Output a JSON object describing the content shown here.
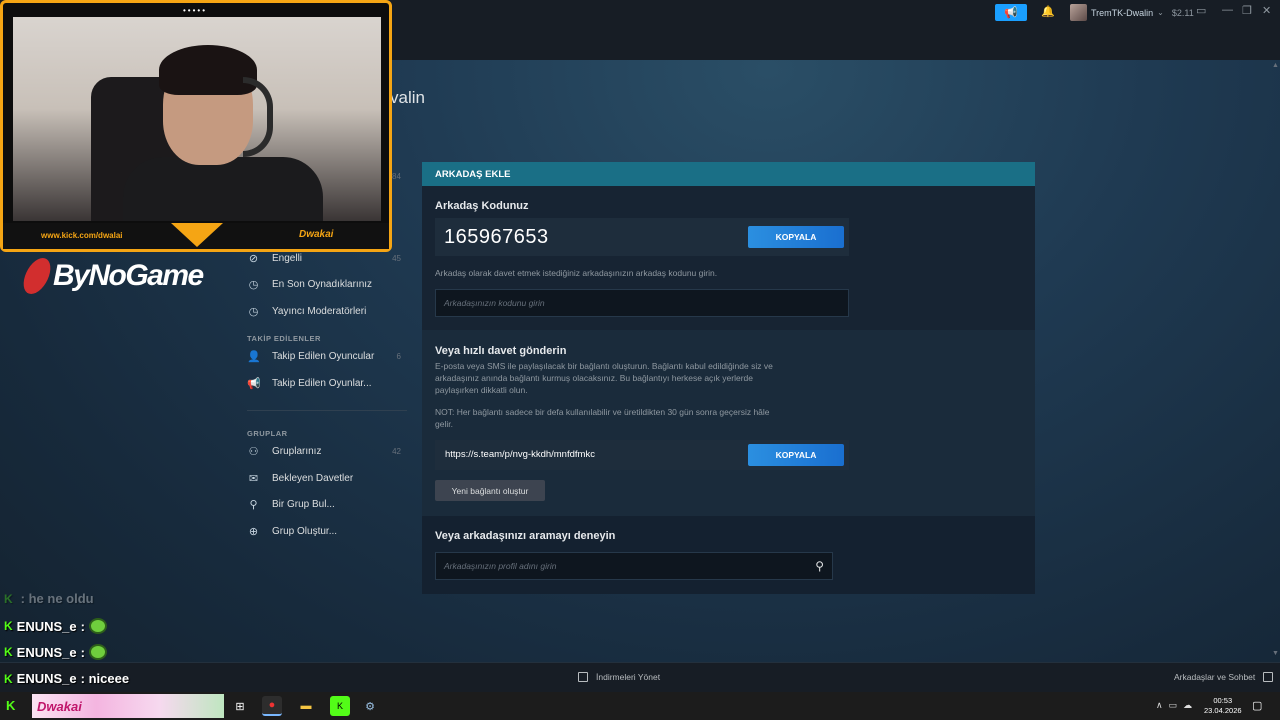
{
  "topbar": {
    "username": "TremTK-Dwalin",
    "balance": "$2.11"
  },
  "page": {
    "title_partial": "valin"
  },
  "webcam": {
    "url": "www.kick.com/dwalai",
    "name": "Dwakai"
  },
  "sponsor": {
    "text": "ByNoGame"
  },
  "sidebar": {
    "top_count": "84",
    "items_a": [
      {
        "label": "Engelli",
        "count": "45"
      },
      {
        "label": "En Son Oynadıklarınız",
        "count": ""
      },
      {
        "label": "Yayıncı Moderatörleri",
        "count": ""
      }
    ],
    "followed_heading": "TAKİP EDİLENLER",
    "followed": [
      {
        "label": "Takip Edilen Oyuncular",
        "count": "6"
      },
      {
        "label": "Takip Edilen Oyunlar...",
        "count": ""
      }
    ],
    "groups_heading": "GRUPLAR",
    "groups": [
      {
        "label": "Gruplarınız",
        "count": "42"
      },
      {
        "label": "Bekleyen Davetler",
        "count": ""
      },
      {
        "label": "Bir Grup Bul...",
        "count": ""
      },
      {
        "label": "Grup Oluştur...",
        "count": ""
      }
    ]
  },
  "panel": {
    "header": "ARKADAŞ EKLE",
    "code_title": "Arkadaş Kodunuz",
    "code_value": "165967653",
    "copy_label": "KOPYALA",
    "code_help": "Arkadaş olarak davet etmek istediğiniz arkadaşınızın arkadaş kodunu girin.",
    "code_placeholder": "Arkadaşınızın kodunu girin",
    "invite_title": "Veya hızlı davet gönderin",
    "invite_desc_1": "E-posta veya SMS ile paylaşılacak bir bağlantı oluşturun. Bağlantı kabul edildiğinde siz ve",
    "invite_desc_2": "arkadaşınız anında bağlantı kurmuş olacaksınız. Bu bağlantıyı herkese açık yerlerde",
    "invite_desc_3": "paylaşırken dikkatli olun.",
    "invite_note_1": "NOT: Her bağlantı sadece bir defa kullanılabilir ve üretildikten 30 gün sonra geçersiz hâle",
    "invite_note_2": "gelir.",
    "invite_link": "https://s.team/p/nvg-kkdh/mnfdfmkc",
    "new_link_label": "Yeni bağlantı oluştur",
    "search_title": "Veya arkadaşınızı aramayı deneyin",
    "search_placeholder": "Arkadaşınızın profil adını girin"
  },
  "chat": [
    {
      "user": "",
      "message": ": he ne oldu"
    },
    {
      "user": "ENUNS_e",
      "message": ""
    },
    {
      "user": "ENUNS_e",
      "message": ""
    },
    {
      "user": "ENUNS_e",
      "message": ": niceee"
    }
  ],
  "bottom": {
    "downloads": "İndirmeleri Yönet",
    "friends": "Arkadaşlar ve Sohbet"
  },
  "taskbar": {
    "banner": "Dwakai",
    "time": "00:53",
    "date": "23.04.2026"
  }
}
